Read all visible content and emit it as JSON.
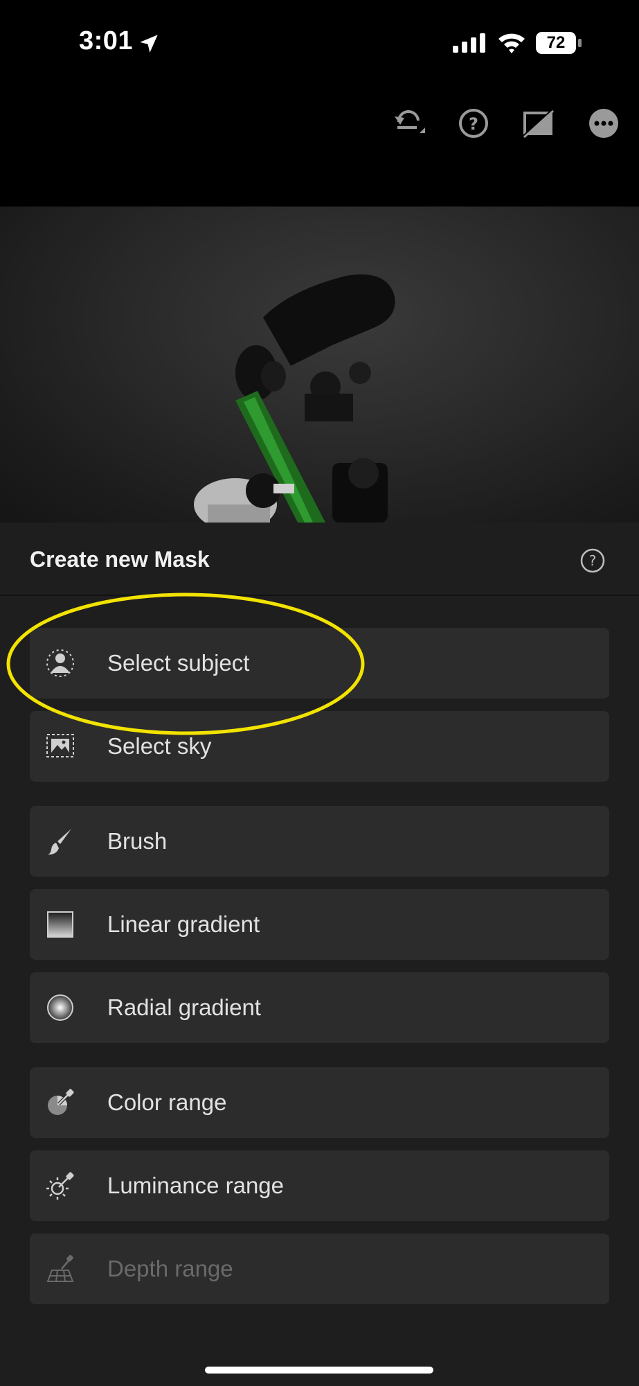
{
  "status_bar": {
    "time": "3:01",
    "battery": "72"
  },
  "toolbar": {
    "icons": [
      "undo-icon",
      "help-icon",
      "before-after-icon",
      "more-icon"
    ]
  },
  "panel": {
    "title": "Create new Mask",
    "items": [
      {
        "label": "Select subject",
        "icon": "select-subject-icon",
        "enabled": true
      },
      {
        "label": "Select sky",
        "icon": "select-sky-icon",
        "enabled": true
      },
      {
        "label": "Brush",
        "icon": "brush-icon",
        "enabled": true
      },
      {
        "label": "Linear gradient",
        "icon": "linear-gradient-icon",
        "enabled": true
      },
      {
        "label": "Radial gradient",
        "icon": "radial-gradient-icon",
        "enabled": true
      },
      {
        "label": "Color range",
        "icon": "color-range-icon",
        "enabled": true
      },
      {
        "label": "Luminance range",
        "icon": "luminance-range-icon",
        "enabled": true
      },
      {
        "label": "Depth range",
        "icon": "depth-range-icon",
        "enabled": false
      }
    ]
  },
  "colors": {
    "highlight": "#f2e300",
    "panel_bg": "#1e1e1e",
    "item_bg": "#2c2c2c"
  }
}
